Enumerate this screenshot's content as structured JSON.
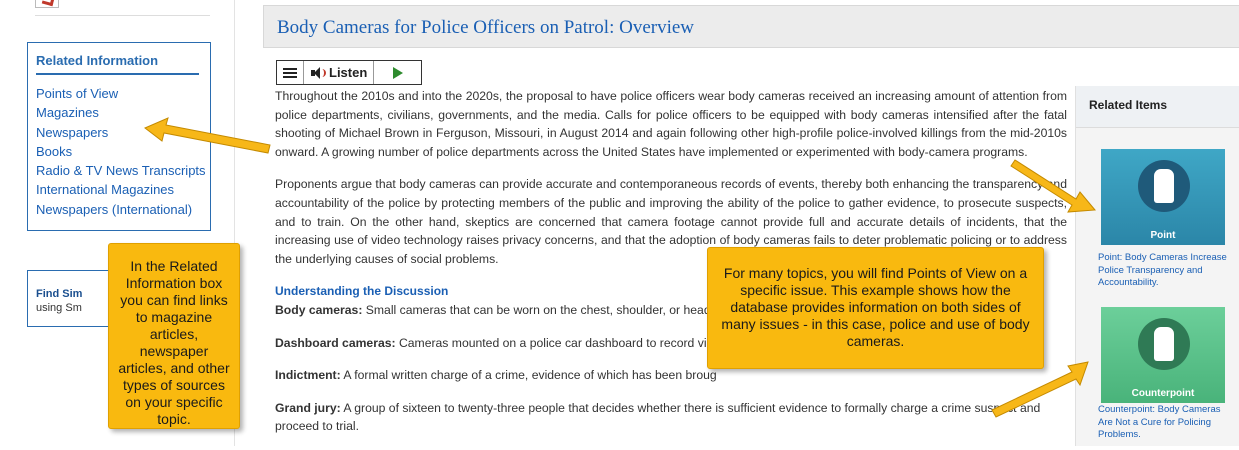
{
  "sidebar": {
    "related_title": "Related Information",
    "related_links": [
      "Points of View",
      "Magazines",
      "Newspapers",
      "Books",
      "Radio & TV News Transcripts",
      "International Magazines",
      "Newspapers (International)"
    ],
    "find_title": "Find Sim",
    "find_sub": "using Sm"
  },
  "article": {
    "title": "Body Cameras for Police Officers on Patrol: Overview",
    "listen_label": "Listen",
    "paragraphs": [
      "Throughout the 2010s and into the 2020s, the proposal to have police officers wear body cameras received an increasing amount of attention from police departments, civilians, governments, and the media. Calls for police officers to be equipped with body cameras intensified after the fatal shooting of Michael Brown in Ferguson, Missouri, in August 2014 and again following other high-profile police-involved killings from the mid-2010s onward. A growing number of police departments across the United States have implemented or experimented with body-camera programs.",
      "Proponents argue that body cameras can provide accurate and contemporaneous records of events, thereby both enhancing the transparency and accountability of the police by protecting members of the public and improving the ability of the police to gather evidence, to prosecute suspects, and to train. On the other hand, skeptics are concerned that camera footage cannot provide full and accurate details of incidents, that the increasing use of video technology raises privacy concerns, and that the adoption of body cameras fails to deter problematic policing or to address the underlying causes of social problems."
    ],
    "section_heading": "Understanding the Discussion",
    "terms": [
      {
        "term": "Body cameras:",
        "def": " Small cameras that can be worn on the chest, shoulder, or head"
      },
      {
        "term": "Dashboard cameras:",
        "def": " Cameras mounted on a police car dashboard to record vi                                                                                                         om the car."
      },
      {
        "term": "Indictment:",
        "def": " A formal written charge of a crime, evidence of which has been broug"
      },
      {
        "term": "Grand jury:",
        "def": " A group of sixteen to twenty-three people that decides whether there is sufficient evidence to formally charge a crime suspect and proceed to trial."
      }
    ]
  },
  "right_panel": {
    "title": "Related Items",
    "items": [
      {
        "tile_label": "Point",
        "link": "Point: Body Cameras Increase Police Transparency and Accountability."
      },
      {
        "tile_label": "Counterpoint",
        "link": "Counterpoint: Body Cameras Are Not a Cure for Policing Problems."
      }
    ]
  },
  "callouts": {
    "left": "In the Related Information box you can find links to magazine articles, newspaper articles, and other types of sources on your specific topic.",
    "right": "For many topics, you will find Points of View on a specific issue.  This example shows how the database provides information on both sides of many issues - in this case, police and use of body cameras."
  },
  "colors": {
    "link_blue": "#1a5fb4",
    "callout_yellow": "#f9b90f",
    "point_tile": "#2b86a8",
    "counterpoint_tile": "#49b37a"
  }
}
